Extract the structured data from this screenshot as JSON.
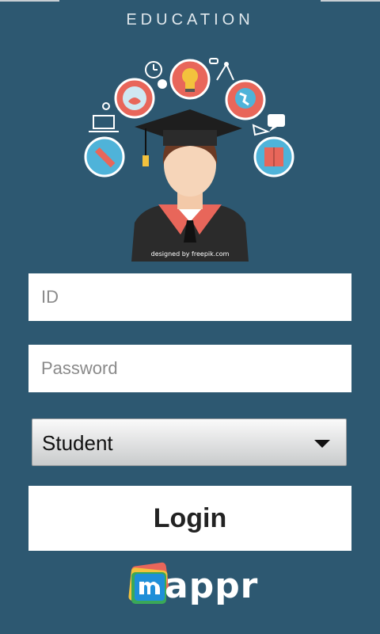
{
  "app": {
    "title": "EDUCATION"
  },
  "hero": {
    "credit": "designed by freepik.com"
  },
  "form": {
    "id_placeholder": "ID",
    "password_placeholder": "Password",
    "role_select": {
      "value": "Student"
    },
    "login_label": "Login"
  },
  "footer": {
    "logo_text": "appr"
  },
  "colors": {
    "background": "#2d5871",
    "field": "#ffffff",
    "accent": "#e8665a",
    "icon_circle": "#4fb3d9"
  },
  "icons": [
    "clock-icon",
    "flask-icon",
    "lightbulb-icon",
    "compass-icon",
    "globe-icon",
    "laptop-icon",
    "pencil-icon",
    "speech-bubble-icon",
    "book-icon",
    "graduation-cap-icon"
  ]
}
